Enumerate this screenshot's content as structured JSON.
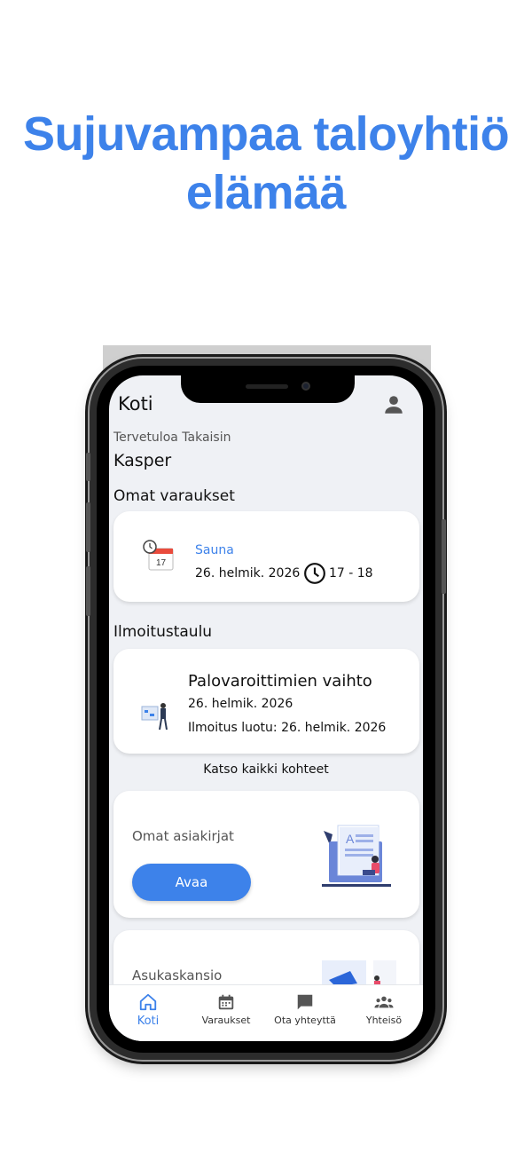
{
  "headline": {
    "line1": "Sujuvampaa taloyhtiö",
    "line2": "elämää"
  },
  "header": {
    "title": "Koti",
    "profile_icon": "person-icon"
  },
  "welcome": {
    "greeting": "Tervetuloa Takaisin",
    "name": "Kasper"
  },
  "reservations": {
    "section_title": "Omat varaukset",
    "item": {
      "name": "Sauna",
      "date": "26. helmik. 2026",
      "time": "17 - 18",
      "icon": "calendar-alarm-icon"
    }
  },
  "noticeboard": {
    "section_title": "Ilmoitustaulu",
    "item": {
      "title": "Palovaroittimien vaihto",
      "date": "26. helmik. 2026",
      "created": "Ilmoitus luotu: 26. helmik. 2026"
    },
    "see_all": "Katso kaikki kohteet"
  },
  "documents": {
    "title": "Omat asiakirjat",
    "button": "Avaa"
  },
  "resident_folder": {
    "title": "Asukaskansio"
  },
  "nav": {
    "items": [
      {
        "label": "Koti",
        "icon": "home-icon",
        "active": true
      },
      {
        "label": "Varaukset",
        "icon": "calendar-icon",
        "active": false
      },
      {
        "label": "Ota yhteyttä",
        "icon": "chat-icon",
        "active": false
      },
      {
        "label": "Yhteisö",
        "icon": "group-icon",
        "active": false
      }
    ]
  },
  "colors": {
    "accent": "#3d82ea",
    "background": "#eff1f5",
    "card": "#ffffff"
  }
}
